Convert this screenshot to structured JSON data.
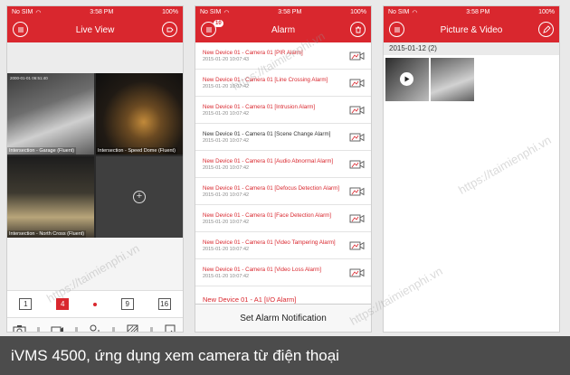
{
  "status_bar": {
    "carrier": "No SIM",
    "time": "3:58 PM",
    "battery": "100%"
  },
  "live_view": {
    "title": "Live View",
    "cameras": [
      {
        "timestamp": "2000-01-01 06:51:40",
        "caption": "Intersection - Garage (Fluent)"
      },
      {
        "timestamp": "",
        "caption": "Intersection - Speed Dome (Fluent)"
      },
      {
        "timestamp": "",
        "caption": "Intersection - North Cross (Fluent)"
      },
      {
        "timestamp": "",
        "caption": ""
      }
    ],
    "split_options": [
      "1",
      "4",
      "9",
      "16"
    ],
    "selected_split": "4"
  },
  "alarm": {
    "title": "Alarm",
    "badge": "10",
    "items": [
      {
        "name": "New Device 01 - Camera 01 [PIR Alarm]",
        "time": "2015-01-20 10:07:43",
        "read": false
      },
      {
        "name": "New Device 01 - Camera 01 [Line Crossing Alarm]",
        "time": "2015-01-20 10:07:42",
        "read": false
      },
      {
        "name": "New Device 01 - Camera 01 [Intrusion Alarm]",
        "time": "2015-01-20 10:07:42",
        "read": false
      },
      {
        "name": "New Device 01 - Camera 01 [Scene Change Alarm]",
        "time": "2015-01-20 10:07:42",
        "read": true
      },
      {
        "name": "New Device 01 - Camera 01 [Audio Abnormal Alarm]",
        "time": "2015-01-20 10:07:42",
        "read": false
      },
      {
        "name": "New Device 01 - Camera 01 [Defocus Detection Alarm]",
        "time": "2015-01-20 10:07:42",
        "read": false
      },
      {
        "name": "New Device 01 - Camera 01 [Face Detection Alarm]",
        "time": "2015-01-20 10:07:42",
        "read": false
      },
      {
        "name": "New Device 01 - Camera 01 [Video Tampering Alarm]",
        "time": "2015-01-20 10:07:42",
        "read": false
      },
      {
        "name": "New Device 01 - Camera 01 [Video Loss Alarm]",
        "time": "2015-01-20 10:07:42",
        "read": false
      },
      {
        "name": "New Device 01 - A1 [I/O Alarm]",
        "time": "",
        "read": false
      }
    ],
    "set_notification": "Set Alarm Notification"
  },
  "picture_video": {
    "title": "Picture & Video",
    "date_group": "2015-01-12 (2)"
  },
  "watermark": "https://taimienphi.vn",
  "caption": "iVMS 4500, ứng dụng xem camera từ điện thoại",
  "colors": {
    "accent": "#d9272e",
    "caption_bg": "#4c4c4c"
  }
}
